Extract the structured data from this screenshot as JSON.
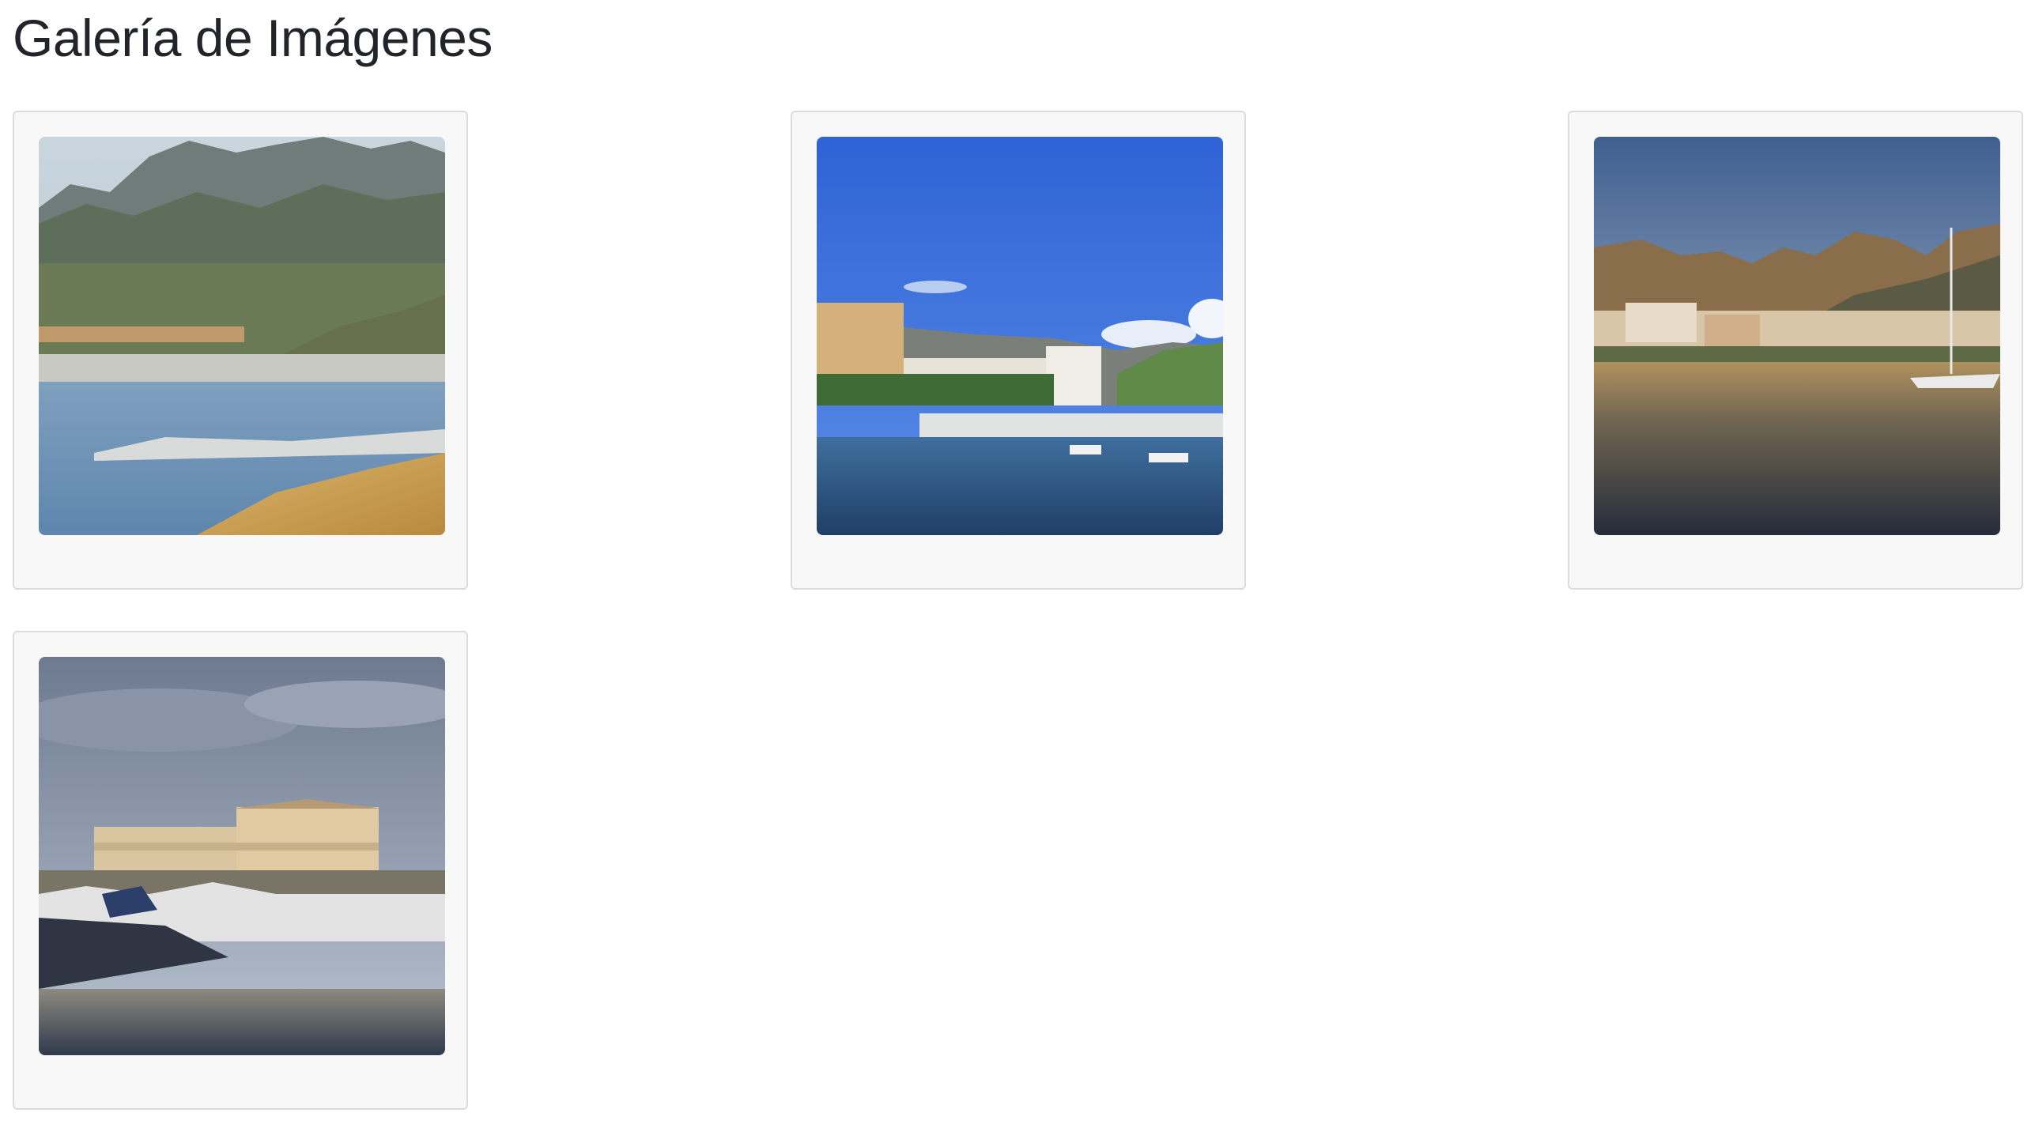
{
  "page": {
    "title": "Galería de Imágenes"
  },
  "gallery": {
    "images": [
      {
        "subject": "aerial view of bay with marina and mountains"
      },
      {
        "subject": "seafront hotels under blue sky with boats"
      },
      {
        "subject": "town reflected in calm water at sunset with sailboat"
      },
      {
        "subject": "marina building with moored motorboats at dusk"
      }
    ]
  }
}
